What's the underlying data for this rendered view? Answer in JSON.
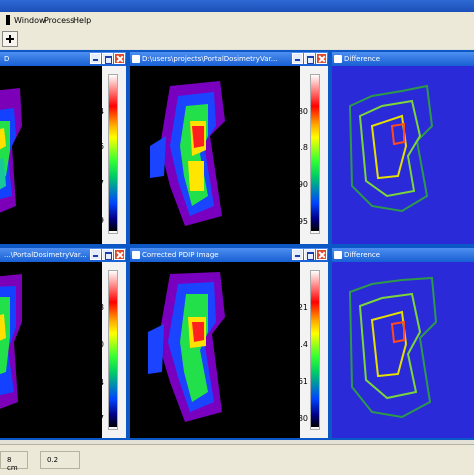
{
  "menu": {
    "items": [
      "Window",
      "Process",
      "Help"
    ]
  },
  "windows": {
    "w1": {
      "title": "D"
    },
    "w2": {
      "title": "D:\\users\\projects\\PortalDosimetryVar..."
    },
    "w3": {
      "title": "Difference"
    },
    "w4": {
      "title": "...\\PortalDosimetryVar..."
    },
    "w5": {
      "title": "Corrected PDIP Image"
    },
    "w6": {
      "title": "Difference"
    }
  },
  "colorbars": {
    "w1": [
      "0.34",
      "0.26",
      "0.17",
      "0.09"
    ],
    "w2": [
      "39.80",
      "29.8",
      "19.90",
      "9.95"
    ],
    "w4": [
      "42.68",
      "32.0",
      "21.34",
      "10.67"
    ],
    "w5": [
      "39.21",
      "29.4",
      "19.61",
      "9.80"
    ]
  },
  "status": {
    "left": "8 cm",
    "middle": "0.2"
  },
  "colors": {
    "xp_title": "#175fd3",
    "window_border": "#0a57c5",
    "close": "#e04b2d",
    "diff_bg": "#2a2ad8"
  },
  "icons": [
    "add-icon",
    "window-icon",
    "minimize-icon",
    "maximize-icon",
    "close-icon"
  ]
}
